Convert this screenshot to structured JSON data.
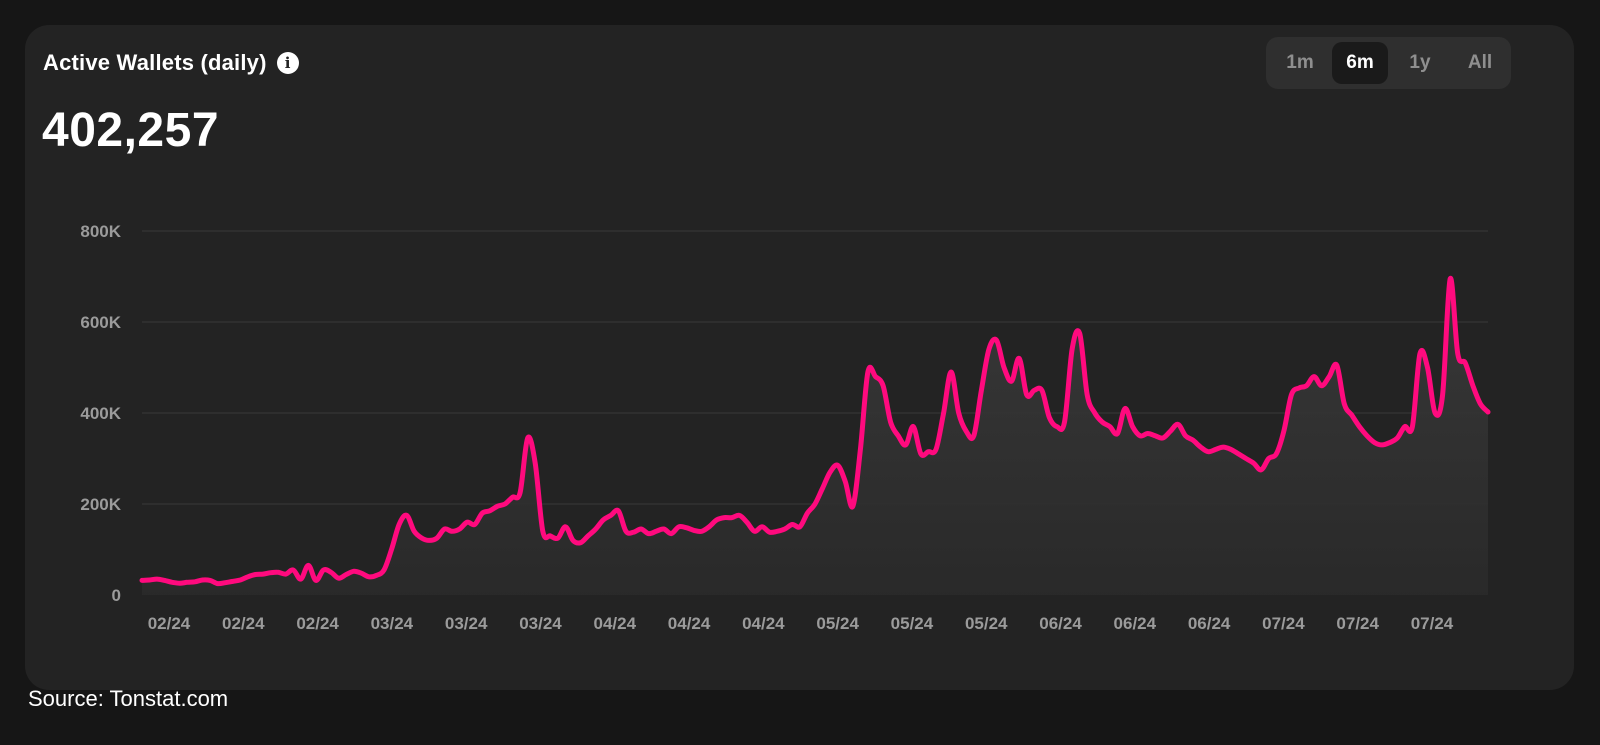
{
  "header": {
    "title": "Active Wallets (daily)",
    "info_icon": "info-icon",
    "current_value": "402,257"
  },
  "range_toggle": {
    "options": [
      "1m",
      "6m",
      "1y",
      "All"
    ],
    "selected": "6m"
  },
  "colors": {
    "line": "#ff0a7e",
    "card": "#232323",
    "background": "#161616",
    "grid": "#3a3a3a",
    "axis_text": "#9b9b9b"
  },
  "source": "Source: Tonstat.com",
  "chart_data": {
    "type": "area",
    "title": "Active Wallets (daily)",
    "xlabel": "",
    "ylabel": "",
    "ylim": [
      0,
      800000
    ],
    "y_ticks": [
      0,
      200000,
      400000,
      600000,
      800000
    ],
    "y_tick_labels": [
      "0",
      "200K",
      "400K",
      "600K",
      "800K"
    ],
    "x_tick_labels": [
      "02/24",
      "02/24",
      "02/24",
      "03/24",
      "03/24",
      "03/24",
      "04/24",
      "04/24",
      "04/24",
      "05/24",
      "05/24",
      "05/24",
      "06/24",
      "06/24",
      "06/24",
      "07/24",
      "07/24",
      "07/24"
    ],
    "grid": true,
    "legend": "none",
    "series": [
      {
        "values": [
          32000,
          33000,
          35000,
          32000,
          28000,
          26000,
          28000,
          29000,
          33000,
          32000,
          25000,
          27000,
          30000,
          33000,
          40000,
          45000,
          46000,
          49000,
          50000,
          46000,
          55000,
          35000,
          65000,
          32000,
          55000,
          50000,
          37000,
          45000,
          52000,
          48000,
          40000,
          43000,
          55000,
          100000,
          155000,
          175000,
          140000,
          125000,
          120000,
          125000,
          145000,
          140000,
          145000,
          160000,
          155000,
          180000,
          185000,
          195000,
          200000,
          215000,
          225000,
          345000,
          290000,
          140000,
          130000,
          125000,
          150000,
          120000,
          115000,
          130000,
          145000,
          165000,
          175000,
          185000,
          140000,
          138000,
          145000,
          135000,
          140000,
          145000,
          135000,
          150000,
          148000,
          142000,
          140000,
          150000,
          165000,
          170000,
          170000,
          175000,
          160000,
          140000,
          150000,
          138000,
          140000,
          145000,
          155000,
          150000,
          180000,
          200000,
          235000,
          270000,
          285000,
          250000,
          195000,
          320000,
          490000,
          480000,
          460000,
          380000,
          350000,
          330000,
          370000,
          310000,
          315000,
          320000,
          400000,
          490000,
          400000,
          360000,
          350000,
          450000,
          540000,
          560000,
          500000,
          470000,
          520000,
          440000,
          450000,
          450000,
          390000,
          370000,
          380000,
          540000,
          575000,
          440000,
          400000,
          380000,
          370000,
          355000,
          410000,
          370000,
          350000,
          355000,
          350000,
          345000,
          360000,
          375000,
          350000,
          340000,
          325000,
          315000,
          320000,
          325000,
          320000,
          310000,
          300000,
          290000,
          275000,
          300000,
          310000,
          360000,
          440000,
          455000,
          460000,
          480000,
          460000,
          480000,
          505000,
          420000,
          395000,
          370000,
          350000,
          335000,
          330000,
          335000,
          345000,
          370000,
          370000,
          530000,
          500000,
          400000,
          440000,
          695000,
          530000,
          510000,
          460000,
          420000,
          402257
        ]
      }
    ]
  }
}
